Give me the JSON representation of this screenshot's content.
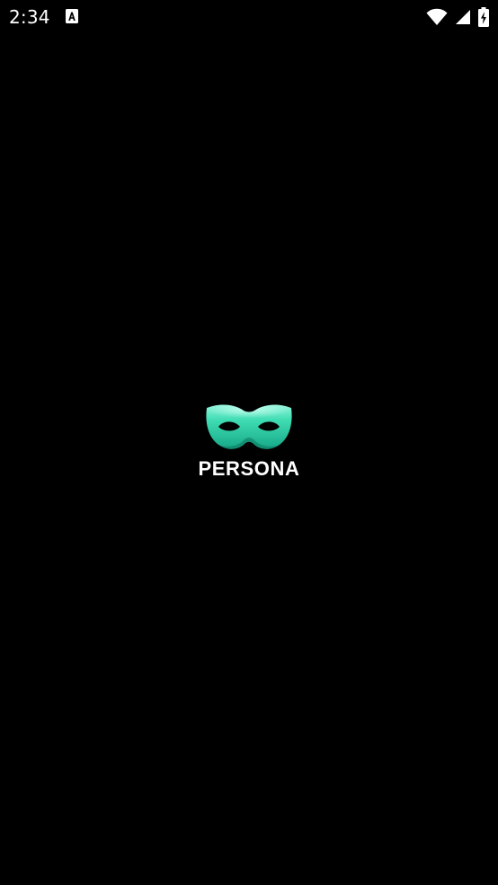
{
  "status_bar": {
    "time": "2:34",
    "notification_icon": "font-a-icon",
    "wifi_icon": "wifi-icon",
    "signal_icon": "cell-signal-icon",
    "battery_icon": "battery-charging-icon"
  },
  "splash": {
    "logo_icon": "theater-mask-icon",
    "brand_name": "PERSONA",
    "colors": {
      "background": "#000000",
      "mask_primary": "#2fd0a6",
      "mask_highlight": "#7ff0d0",
      "mask_shadow": "#14806a",
      "brand_text": "#ffffff"
    }
  }
}
